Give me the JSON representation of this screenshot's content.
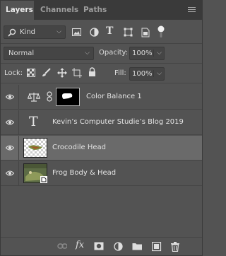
{
  "tabs": [
    {
      "label": "Layers",
      "active": true
    },
    {
      "label": "Channels",
      "active": false
    },
    {
      "label": "Paths",
      "active": false
    }
  ],
  "filter": {
    "kind_label": "Kind",
    "icons": [
      "image-filter-icon",
      "adjustment-filter-icon",
      "type-filter-icon",
      "shape-filter-icon",
      "smart-object-filter-icon",
      "filter-toggle-icon"
    ]
  },
  "blend": {
    "mode": "Normal",
    "opacity_label": "Opacity:",
    "opacity_value": "100%"
  },
  "lock": {
    "label": "Lock:",
    "icons": [
      "lock-transparent-pixels-icon",
      "lock-image-pixels-icon",
      "lock-position-icon",
      "lock-artboard-icon",
      "lock-all-icon"
    ],
    "fill_label": "Fill:",
    "fill_value": "100%"
  },
  "layers": [
    {
      "name": "Color Balance 1",
      "type": "adjustment",
      "visible": true,
      "selected": false
    },
    {
      "name": "Kevin’s Computer Studie’s Blog 2019",
      "type": "text",
      "visible": true,
      "selected": false
    },
    {
      "name": "Crocodile Head",
      "type": "pixel",
      "visible": true,
      "selected": true
    },
    {
      "name": "Frog Body & Head",
      "type": "smart-object",
      "visible": true,
      "selected": false
    }
  ],
  "bottom_icons": [
    "link-layers-icon",
    "fx-icon",
    "add-mask-icon",
    "new-adjustment-icon",
    "new-group-icon",
    "new-layer-icon",
    "delete-layer-icon"
  ],
  "colors": {
    "panel_bg": "#535353",
    "tab_bar_bg": "#3a3a3a",
    "selected_row": "#6a6a6a"
  }
}
